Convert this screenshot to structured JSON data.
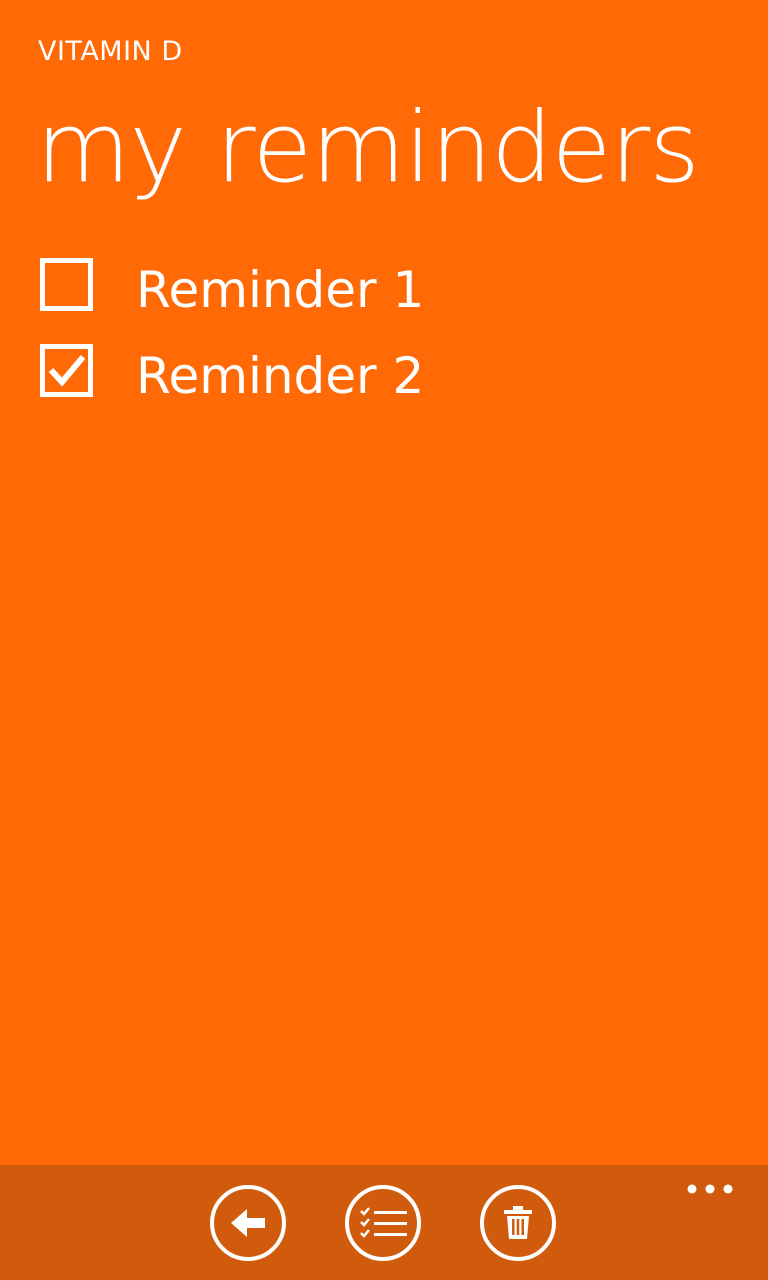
{
  "app": {
    "title": "VITAMIN D",
    "page_title": "my reminders"
  },
  "reminders": [
    {
      "label": "Reminder 1",
      "checked": false
    },
    {
      "label": "Reminder 2",
      "checked": true
    }
  ],
  "app_bar": {
    "buttons": [
      {
        "icon": "back-arrow-icon"
      },
      {
        "icon": "checklist-icon"
      },
      {
        "icon": "trash-icon"
      }
    ],
    "more_icon": "ellipsis-icon"
  },
  "colors": {
    "background": "#FF6A07",
    "app_bar": "#D15B0C",
    "foreground": "#FFFFFF"
  }
}
